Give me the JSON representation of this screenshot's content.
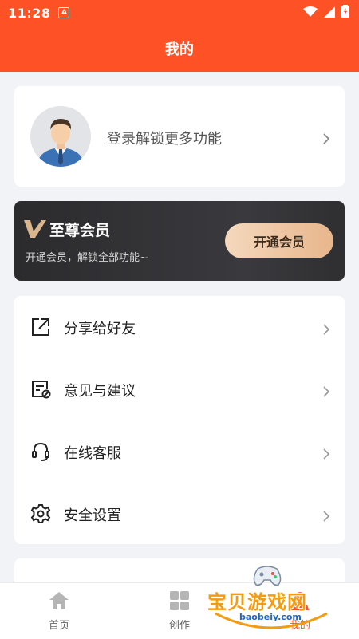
{
  "status_bar": {
    "time": "11:28",
    "badge": "A"
  },
  "header": {
    "title": "我的"
  },
  "profile": {
    "login_text": "登录解锁更多功能"
  },
  "vip": {
    "title": "至尊会员",
    "subtitle": "开通会员，解锁全部功能~",
    "button_label": "开通会员",
    "accent": "#e8b68c"
  },
  "menu": {
    "items": [
      {
        "label": "分享给好友",
        "icon": "share-icon"
      },
      {
        "label": "意见与建议",
        "icon": "feedback-icon"
      },
      {
        "label": "在线客服",
        "icon": "headset-icon"
      },
      {
        "label": "安全设置",
        "icon": "gear-icon"
      }
    ]
  },
  "bottom_nav": {
    "items": [
      {
        "label": "首页",
        "icon": "home-icon"
      },
      {
        "label": "创作",
        "icon": "grid-icon"
      },
      {
        "label": "我的",
        "icon": "profile-icon"
      }
    ]
  },
  "watermark": {
    "text": "宝贝游戏网",
    "url": "baobeiy.com"
  },
  "colors": {
    "brand": "#fe5126",
    "background": "#f2f3f7"
  }
}
